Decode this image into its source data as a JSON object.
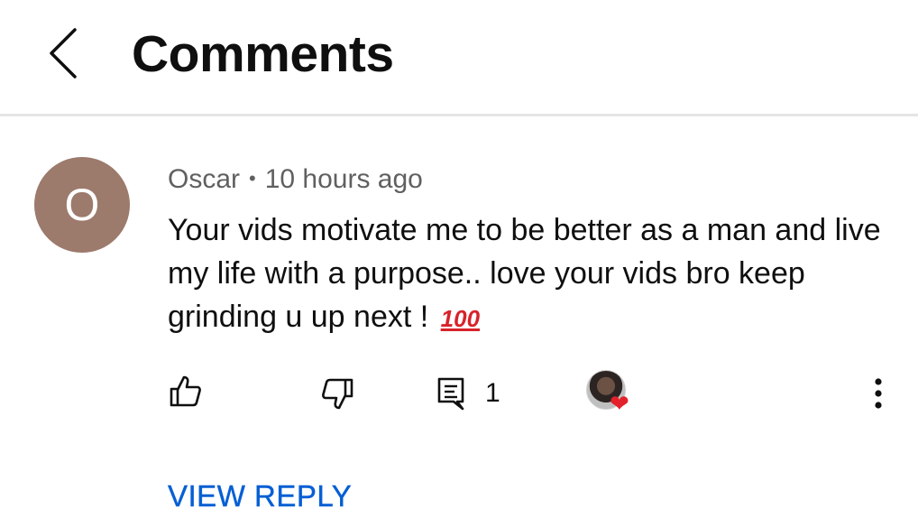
{
  "header": {
    "title": "Comments",
    "back_icon": "chevron-left-icon"
  },
  "comment": {
    "avatar_letter": "O",
    "avatar_color": "#9c7a6c",
    "author": "Oscar",
    "separator": "•",
    "time": "10 hours ago",
    "text": "Your vids motivate me to be better as a man and live my life with a purpose.. love your vids bro keep grinding u up next !",
    "emoji": "100",
    "emoji_icon": "hundred-points-emoji",
    "reply_count": "1",
    "creator_heart": true
  },
  "actions": {
    "like_icon": "thumbs-up-icon",
    "dislike_icon": "thumbs-down-icon",
    "reply_icon": "comment-reply-icon",
    "heart_icon": "creator-heart-icon",
    "more_icon": "more-vertical-icon"
  },
  "view_reply_label": "VIEW REPLY",
  "colors": {
    "link": "#065fd4",
    "meta": "#606060",
    "heart": "#e3212a"
  }
}
